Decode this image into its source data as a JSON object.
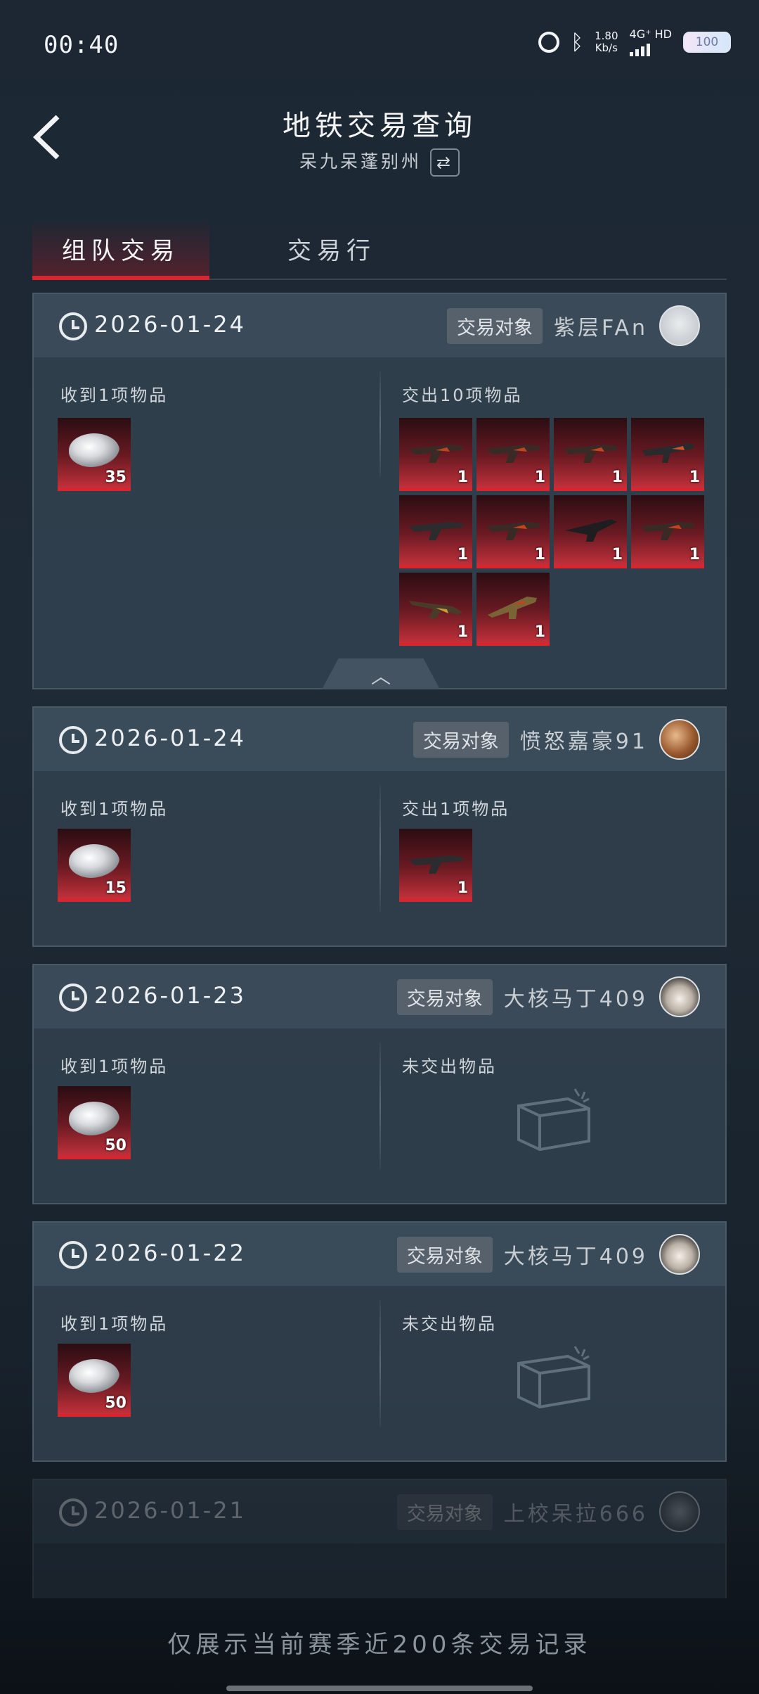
{
  "status_bar": {
    "time": "00:40",
    "net_speed": "1.80",
    "net_speed_unit": "Kb/s",
    "network": "4G⁺ HD",
    "battery": "100"
  },
  "header": {
    "title": "地铁交易查询",
    "subtitle": "呆九呆蓬别州"
  },
  "tabs": [
    {
      "label": "组队交易",
      "active": true
    },
    {
      "label": "交易行",
      "active": false
    }
  ],
  "partner_badge": "交易对象",
  "records": [
    {
      "date": "2026-01-24",
      "partner_name": "紫层FAn",
      "received_label": "收到1项物品",
      "received_qty": "35",
      "sold_label": "交出10项物品",
      "sold_qty": [
        "1",
        "1",
        "1",
        "1",
        "1",
        "1",
        "1",
        "1",
        "1",
        "1"
      ]
    },
    {
      "date": "2026-01-24",
      "partner_name": "愤怒嘉豪91",
      "received_label": "收到1项物品",
      "received_qty": "15",
      "sold_label": "交出1项物品",
      "sold_qty": [
        "1"
      ]
    },
    {
      "date": "2026-01-23",
      "partner_name": "大核马丁409",
      "received_label": "收到1项物品",
      "received_qty": "50",
      "sold_label": "未交出物品"
    },
    {
      "date": "2026-01-22",
      "partner_name": "大核马丁409",
      "received_label": "收到1项物品",
      "received_qty": "50",
      "sold_label": "未交出物品"
    },
    {
      "date": "2026-01-21",
      "partner_name": "上校呆拉666"
    }
  ],
  "footer_note": "仅展示当前赛季近200条交易记录",
  "icons": {
    "back": "chevron-left-icon",
    "swap": "swap-arrows-icon",
    "clock": "clock-icon",
    "collapse": "chevron-up-icon",
    "empty": "empty-box-icon"
  }
}
